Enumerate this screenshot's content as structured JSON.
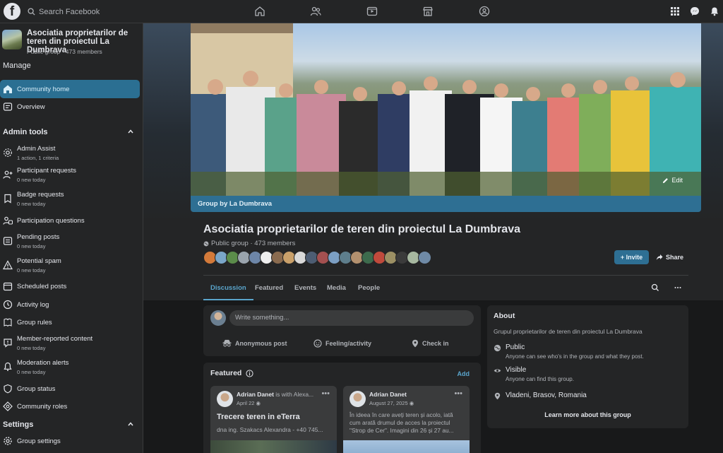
{
  "topbar": {
    "logo": "f",
    "search_placeholder": "Search Facebook",
    "nav_icons": [
      "home-icon",
      "friends-icon",
      "video-icon",
      "marketplace-icon",
      "groups-icon"
    ],
    "right_icons": [
      "menu-grid-icon",
      "messenger-icon",
      "notifications-icon"
    ]
  },
  "sidebar": {
    "group_name": "Asociatia proprietarilor de teren din proiectul La Dumbrava",
    "group_meta": "Public group · 473 members",
    "manage_label": "Manage",
    "community_home": "Community home",
    "overview": "Overview",
    "admin_tools_label": "Admin tools",
    "admin_items": [
      {
        "label": "Admin Assist",
        "sub": "1 action, 1 criteria",
        "icon": "admin-assist-icon"
      },
      {
        "label": "Participant requests",
        "sub": "0 new today",
        "icon": "person-add-icon"
      },
      {
        "label": "Badge requests",
        "sub": "0 new today",
        "icon": "badge-icon"
      },
      {
        "label": "Participation questions",
        "sub": "",
        "icon": "question-icon"
      },
      {
        "label": "Pending posts",
        "sub": "0 new today",
        "icon": "pending-icon"
      },
      {
        "label": "Potential spam",
        "sub": "0 new today",
        "icon": "warning-icon"
      },
      {
        "label": "Scheduled posts",
        "sub": "",
        "icon": "calendar-icon"
      },
      {
        "label": "Activity log",
        "sub": "",
        "icon": "clock-icon"
      },
      {
        "label": "Group rules",
        "sub": "",
        "icon": "rules-icon"
      },
      {
        "label": "Member-reported content",
        "sub": "0 new today",
        "icon": "report-icon"
      },
      {
        "label": "Moderation alerts",
        "sub": "0 new today",
        "icon": "alert-bell-icon"
      },
      {
        "label": "Group status",
        "sub": "",
        "icon": "shield-icon"
      },
      {
        "label": "Community roles",
        "sub": "",
        "icon": "roles-icon"
      }
    ],
    "settings_label": "Settings",
    "settings_items": [
      {
        "label": "Group settings",
        "icon": "gear-icon"
      }
    ]
  },
  "cover": {
    "caption": "Group by La Dumbrava",
    "edit_label": "Edit"
  },
  "group": {
    "title": "Asociatia proprietarilor de teren din proiectul La Dumbrava",
    "meta": "Public group · 473 members",
    "invite_label": "+ Invite",
    "share_label": "Share"
  },
  "tabs": [
    "Discussion",
    "Featured",
    "Events",
    "Media",
    "People"
  ],
  "composer": {
    "placeholder": "Write something...",
    "actions": [
      "Anonymous post",
      "Feeling/activity",
      "Check in"
    ]
  },
  "featured": {
    "title": "Featured",
    "add_label": "Add",
    "posts": [
      {
        "author": "Adrian Danet",
        "with": "is with Alexa...",
        "date": "April 22",
        "title": "Trecere teren in eTerra",
        "text": "dna ing. Szakacs Alexandra - +40 745..."
      },
      {
        "author": "Adrian Danet",
        "with": "",
        "date": "August 27, 2025",
        "title": "",
        "text": "În ideea în care aveți teren și acolo, iată cum arată drumul de acces la proiectul \"Strop de Cer\". Imagini din 26 și 27 au..."
      }
    ]
  },
  "about": {
    "heading": "About",
    "description": "Grupul proprietarilor de teren din proiectul La Dumbrava",
    "rows": [
      {
        "title": "Public",
        "sub": "Anyone can see who's in the group and what they post.",
        "icon": "globe-icon"
      },
      {
        "title": "Visible",
        "sub": "Anyone can find this group.",
        "icon": "eye-icon"
      },
      {
        "title": "Vladeni, Brasov, Romania",
        "sub": "",
        "icon": "location-pin-icon"
      }
    ],
    "link": "Learn more about this group"
  },
  "colors": {
    "accent": "#2e6f93",
    "link": "#5aa5cc",
    "surface": "#242526",
    "background": "#18191a"
  }
}
